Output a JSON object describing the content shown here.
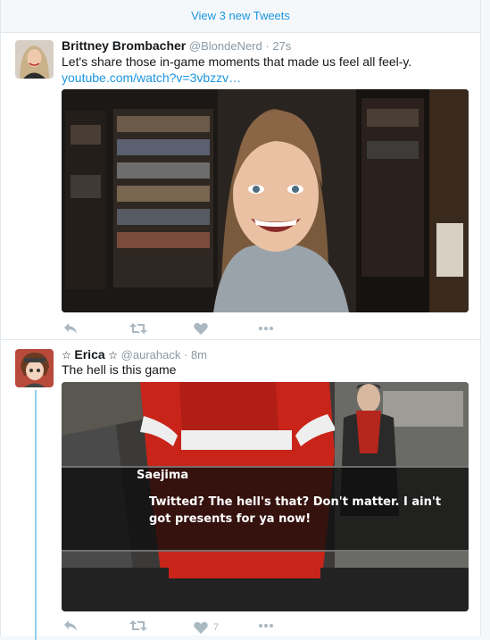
{
  "banner": {
    "label": "View 3 new Tweets"
  },
  "tweets": [
    {
      "fullname": "Brittney Brombacher",
      "username": "@BlondeNerd",
      "time": "27s",
      "text": "Let's share those in-game moments that made us feel all feel-y.",
      "link": "youtube.com/watch?v=3vbzzv…",
      "media": "video-thumbnail",
      "like_count": ""
    },
    {
      "fullname": "Erica",
      "name_decoration": "☆",
      "username": "@aurahack",
      "time": "8m",
      "text": "The hell is this game",
      "media": "game-screenshot",
      "subtitle_speaker": "Saejima",
      "subtitle_line1": "Twitted? The hell's that? Don't matter. I ain't",
      "subtitle_line2": "got presents for ya now!",
      "like_count": "7"
    }
  ],
  "separator": "·",
  "colors": {
    "link": "#1b95e0",
    "muted": "#8899a6",
    "action": "#aab8c2",
    "thread": "#8ecdf0"
  }
}
